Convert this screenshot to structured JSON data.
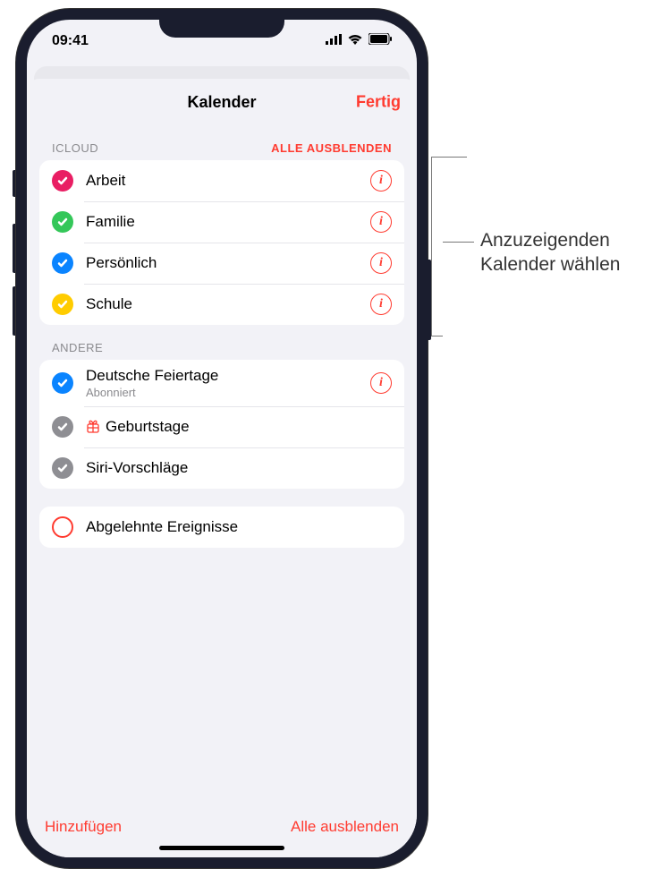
{
  "status": {
    "time": "09:41"
  },
  "header": {
    "title": "Kalender",
    "done": "Fertig"
  },
  "sections": {
    "icloud": {
      "title": "ICLOUD",
      "action": "ALLE AUSBLENDEN",
      "items": [
        {
          "label": "Arbeit",
          "color": "#e91e63",
          "checked": true,
          "info": true
        },
        {
          "label": "Familie",
          "color": "#34c759",
          "checked": true,
          "info": true
        },
        {
          "label": "Persönlich",
          "color": "#0a84ff",
          "checked": true,
          "info": true
        },
        {
          "label": "Schule",
          "color": "#ffcc00",
          "checked": true,
          "info": true
        }
      ]
    },
    "other": {
      "title": "ANDERE",
      "items": [
        {
          "label": "Deutsche Feiertage",
          "sublabel": "Abonniert",
          "color": "#0a84ff",
          "checked": true,
          "info": true
        },
        {
          "label": "Geburtstage",
          "color": "#8e8e93",
          "checked": true,
          "info": false,
          "giftIcon": true
        },
        {
          "label": "Siri-Vorschläge",
          "color": "#8e8e93",
          "checked": true,
          "info": false
        }
      ]
    },
    "declined": {
      "items": [
        {
          "label": "Abgelehnte Ereignisse",
          "checked": false
        }
      ]
    }
  },
  "footer": {
    "add": "Hinzufügen",
    "hideAll": "Alle ausblenden"
  },
  "callout": {
    "line1": "Anzuzeigenden",
    "line2": "Kalender wählen"
  }
}
